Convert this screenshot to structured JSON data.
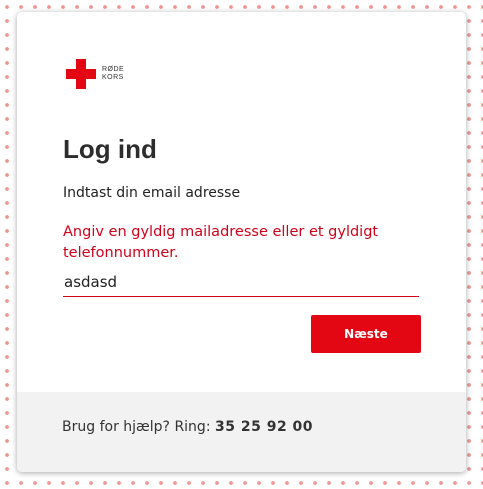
{
  "logo": {
    "line1": "RØDE",
    "line2": "KORS",
    "brand_color": "#e30613"
  },
  "login": {
    "title": "Log ind",
    "subtitle": "Indtast din email adresse",
    "error": "Angiv en gyldig mailadresse eller et gyldigt telefonnummer.",
    "input_value": "asdasd",
    "next_label": "Næste"
  },
  "footer": {
    "help_text": "Brug for hjælp? Ring:",
    "phone": "35 25 92 00"
  }
}
